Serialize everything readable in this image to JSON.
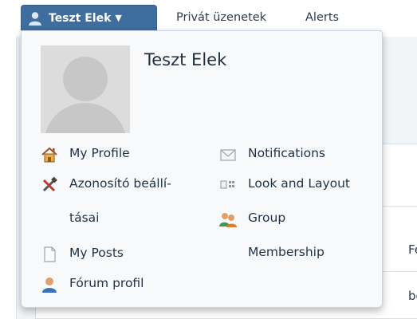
{
  "nav": {
    "user_button": "Teszt Elek",
    "caret": "▼",
    "private_messages": "Privát üzenetek",
    "alerts": "Alerts"
  },
  "dropdown": {
    "username": "Teszt Elek",
    "left_items": [
      {
        "label": "My Profile",
        "icon": "home-icon"
      },
      {
        "label_line1": "Azonosító beállí-",
        "label_line2": "tásai",
        "icon": "tools-icon"
      },
      {
        "label": "My Posts",
        "icon": "document-icon"
      },
      {
        "label": "Fórum profil",
        "icon": "person-icon"
      }
    ],
    "right_items": [
      {
        "label": "Notifications",
        "icon": "envelope-icon"
      },
      {
        "label": "Look and Layout",
        "icon": "layout-icon"
      },
      {
        "label_line1": "Group",
        "label_line2": "Membership",
        "icon": "group-icon"
      }
    ]
  },
  "background": {
    "fragment_1": "Fe",
    "fragment_2": "be"
  },
  "colors": {
    "nav_button_bg": "#3f6d9e",
    "dropdown_bg": "#f7f9fb",
    "text": "#1e3247"
  }
}
